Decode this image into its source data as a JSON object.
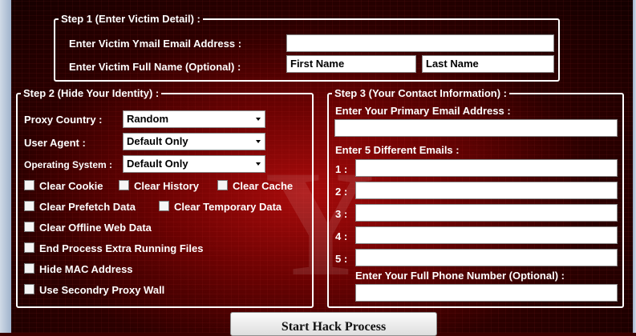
{
  "step1": {
    "legend": "Step 1 (Enter Victim Detail) :",
    "email_label": "Enter Victim Ymail Email Address :",
    "email_value": "",
    "name_label": "Enter Victim Full Name (Optional) :",
    "first_name_placeholder": "First Name",
    "last_name_placeholder": "Last Name"
  },
  "step2": {
    "legend": "Step 2 (Hide Your Identity) :",
    "proxy_country_label": "Proxy Country :",
    "proxy_country_value": "Random",
    "user_agent_label": "User Agent :",
    "user_agent_value": "Default Only",
    "os_label": "Operating System :",
    "os_value": "Default Only",
    "checkboxes": {
      "clear_cookie": "Clear Cookie",
      "clear_history": "Clear History",
      "clear_cache": "Clear Cache",
      "clear_prefetch": "Clear Prefetch Data",
      "clear_temporary": "Clear Temporary Data",
      "clear_offline": "Clear Offline Web Data",
      "end_process": "End Process Extra Running Files",
      "hide_mac": "Hide MAC Address",
      "secondry_proxy": "Use Secondry Proxy Wall"
    }
  },
  "step3": {
    "legend": "Step 3 (Your Contact Information) :",
    "primary_email_label": "Enter Your Primary Email Address :",
    "primary_email_value": "",
    "different_emails_label": "Enter 5 Different Emails :",
    "email_numbers": [
      "1 :",
      "2 :",
      "3 :",
      "4 :",
      "5 :"
    ],
    "phone_label": "Enter Your Full Phone Number (Optional) :",
    "phone_value": ""
  },
  "start_button_label": "Start Hack Process",
  "icons": {
    "dropdown": "chevron-down-icon",
    "background_logo": "y-logo-icon"
  }
}
